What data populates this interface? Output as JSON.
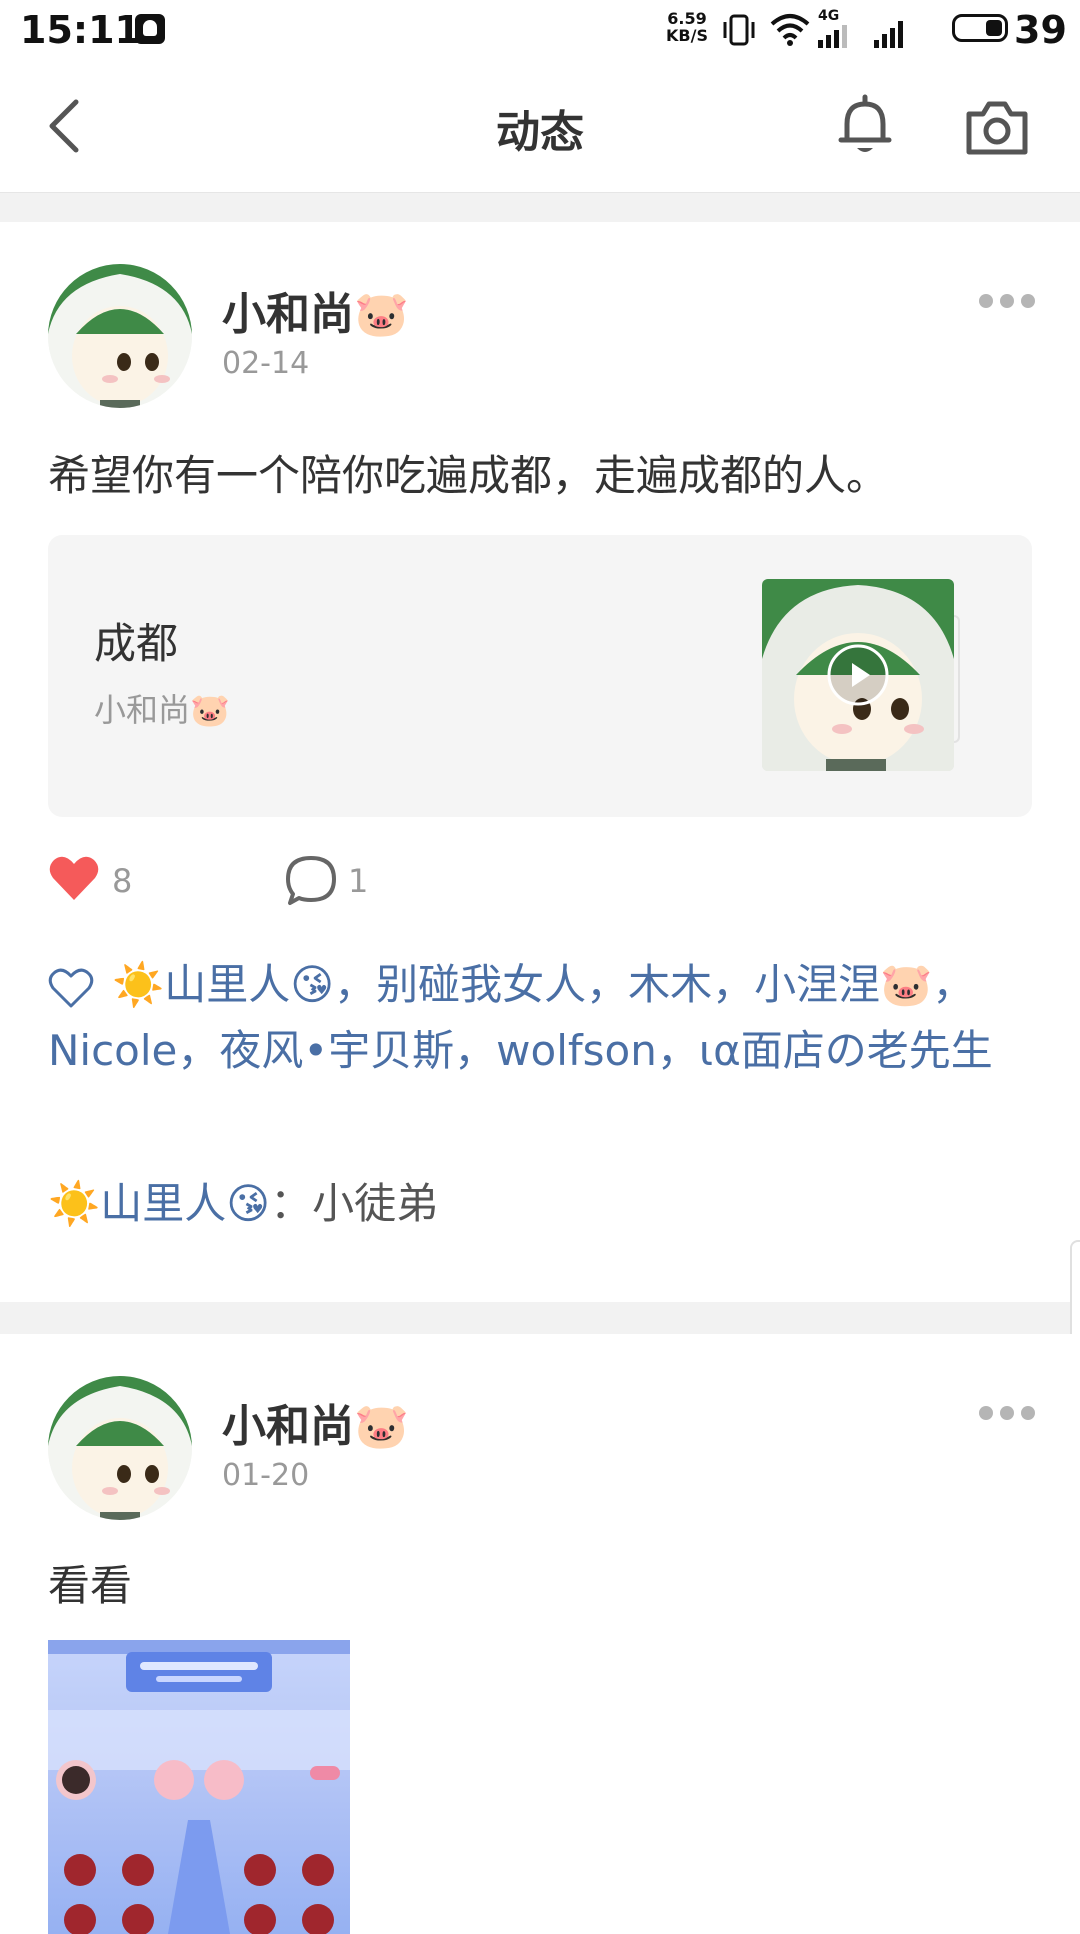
{
  "status_bar": {
    "time": "15:11",
    "net_speed_value": "6.59",
    "net_speed_unit": "KB/S",
    "signal_label": "4G",
    "battery": "39"
  },
  "nav": {
    "title": "动态",
    "back_icon": "chevron-left-icon",
    "bell_icon": "bell-icon",
    "camera_icon": "camera-icon"
  },
  "posts": [
    {
      "username": "小和尚🐷",
      "date": "02-14",
      "text": "希望你有一个陪你吃遍成都，走遍成都的人。",
      "share": {
        "title": "成都",
        "author": "小和尚🐷"
      },
      "like_count": "8",
      "comment_count": "1",
      "likers_text": "☀️山里人😘，别碰我女人，木木，小涅涅🐷，Nicole，夜风•宇贝斯，wolfson，ια面店の老先生",
      "comment": {
        "author": "☀️山里人😘",
        "separator": "：",
        "text": "小徒弟"
      }
    },
    {
      "username": "小和尚🐷",
      "date": "01-20",
      "text": "看看"
    }
  ],
  "colors": {
    "link_blue": "#4a6fa5",
    "like_red": "#f55a5a",
    "gray_text": "#999999"
  }
}
